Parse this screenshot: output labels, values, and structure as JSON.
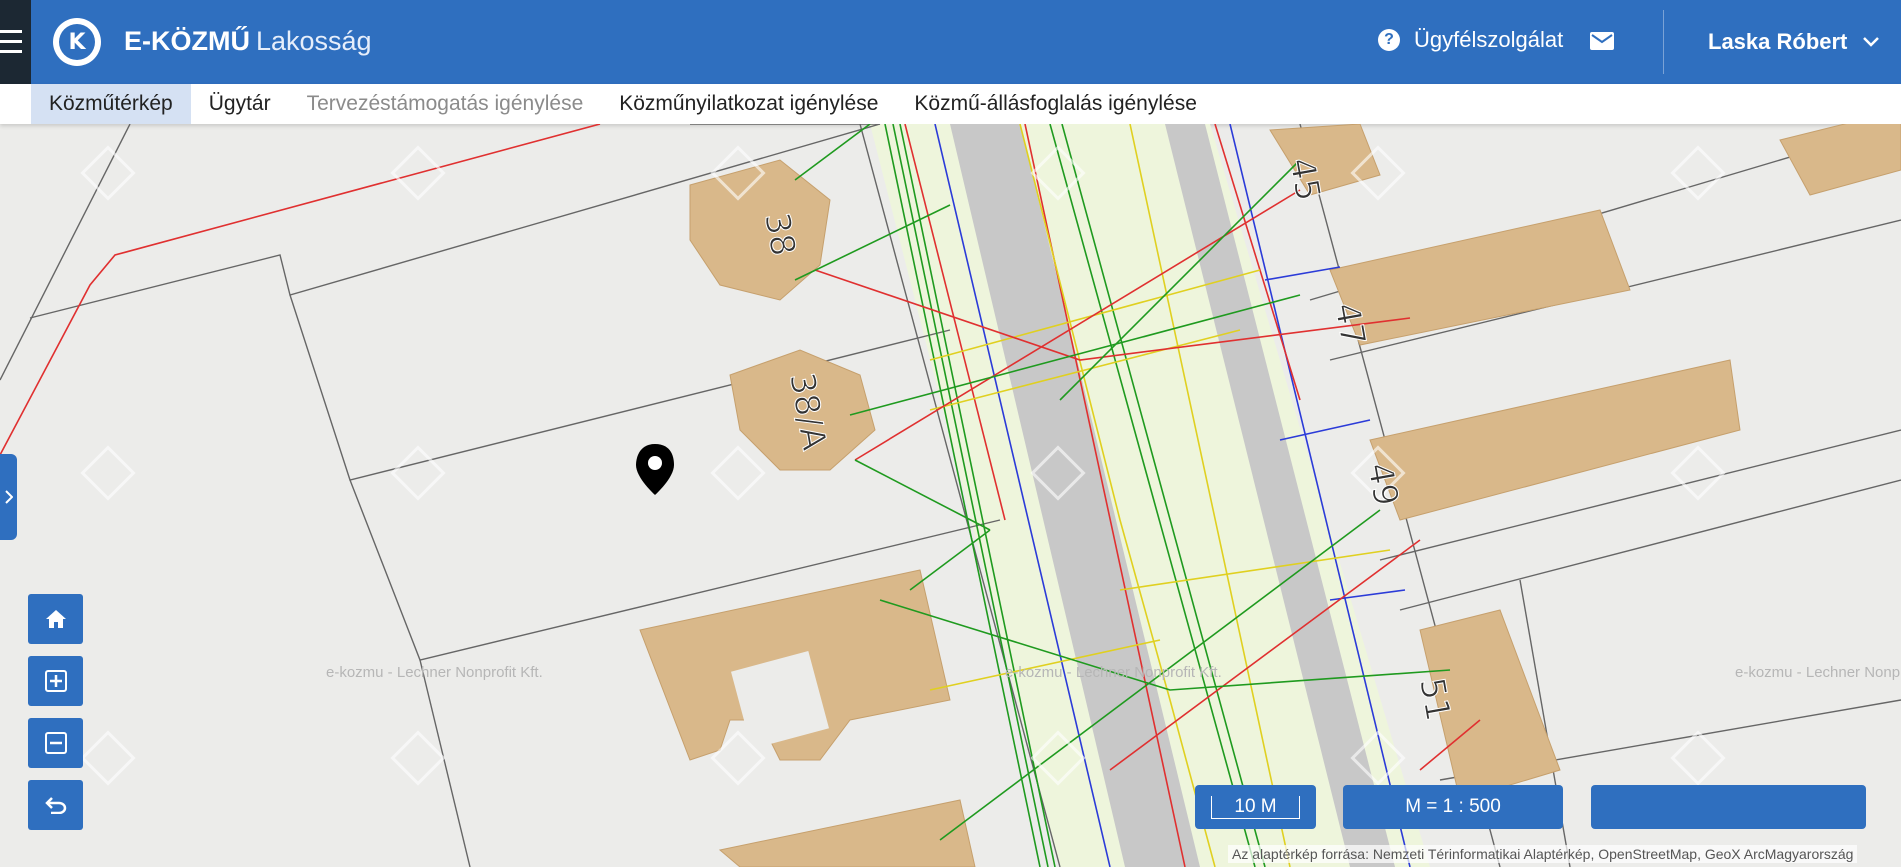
{
  "header": {
    "brand_bold": "E-KÖZMŰ",
    "brand_light": "Lakosság",
    "logo_letter": "K",
    "help_label": "Ügyfélszolgálat",
    "user_name": "Laska Róbert",
    "accent_color": "#2f6fbf"
  },
  "nav": {
    "items": [
      {
        "label": "Közműtérkép"
      },
      {
        "label": "Ügytár"
      },
      {
        "label": "Tervezéstámogatás igénylése"
      },
      {
        "label": "Közműnyilatkozat igénylése"
      },
      {
        "label": "Közmű-állásfoglalás igénylése"
      }
    ]
  },
  "map": {
    "house_numbers": [
      "45",
      "38",
      "47",
      "38/A",
      "49",
      "51"
    ],
    "watermark_text": "e-kozmu - Lechner Nonprofit Kft.",
    "scale_bar": "10 M",
    "scale_ratio": "M = 1 : 500",
    "attribution": "Az alaptérkép forrása: Nemzeti Térinformatikai Alaptérkép, OpenStreetMap, GeoX ArcMagyarország"
  }
}
